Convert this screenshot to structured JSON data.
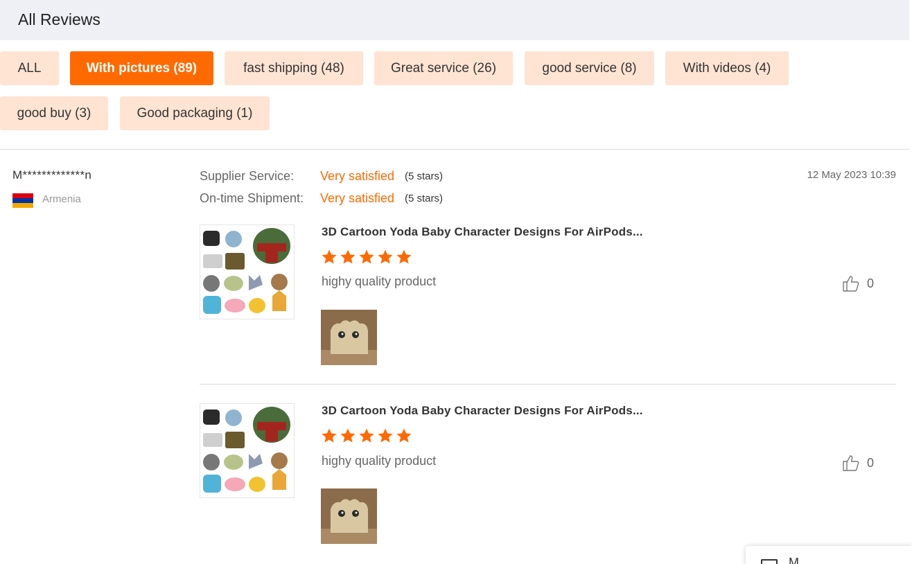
{
  "header": {
    "title": "All Reviews"
  },
  "filters": [
    {
      "label": "ALL",
      "active": false
    },
    {
      "label": "With pictures (89)",
      "active": true
    },
    {
      "label": "fast shipping (48)",
      "active": false
    },
    {
      "label": "Great service (26)",
      "active": false
    },
    {
      "label": "good service (8)",
      "active": false
    },
    {
      "label": "With videos (4)",
      "active": false
    },
    {
      "label": "good buy (3)",
      "active": false
    },
    {
      "label": "Good packaging (1)",
      "active": false
    }
  ],
  "review": {
    "reviewer": "M*************n",
    "country": "Armenia",
    "date": "12 May 2023 10:39",
    "ratings": [
      {
        "label": "Supplier Service:",
        "value": "Very satisfied",
        "stars": "(5 stars)"
      },
      {
        "label": "On-time Shipment:",
        "value": "Very satisfied",
        "stars": "(5 stars)"
      }
    ],
    "items": [
      {
        "product_title": "3D Cartoon Yoda Baby Character Designs For AirPods...",
        "rating": 5,
        "text": "highy quality product",
        "likes": "0"
      },
      {
        "product_title": "3D Cartoon Yoda Baby Character Designs For AirPods...",
        "rating": 5,
        "text": "highy quality product",
        "likes": "0"
      }
    ]
  },
  "float_panel": {
    "label": "M"
  },
  "colors": {
    "accent": "#ff6a00",
    "chip_bg": "#ffe4d3",
    "header_bg": "#eef0f5"
  }
}
